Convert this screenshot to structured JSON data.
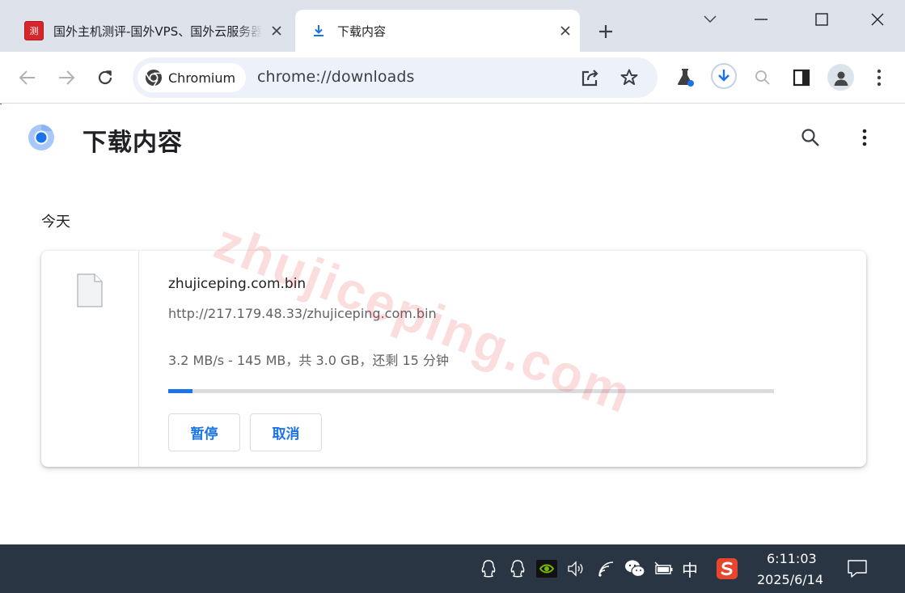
{
  "window": {
    "tabs": [
      {
        "title": "国外主机测评-国外VPS、国外云服务器",
        "favicon": "site-logo-icon",
        "favicon_text": "测"
      },
      {
        "title": "下载内容",
        "favicon": "download-icon",
        "active": true
      }
    ],
    "controls": [
      "chevron-down-icon",
      "minimize-icon",
      "maximize-icon",
      "close-icon"
    ]
  },
  "toolbar": {
    "chip_label": "Chromium",
    "url": "chrome://downloads",
    "icons": [
      "back-icon",
      "forward-icon",
      "reload-icon",
      "share-icon",
      "star-icon",
      "labs-flask-icon",
      "download-indicator-icon",
      "search-icon",
      "side-panel-icon",
      "profile-avatar-icon",
      "kebab-menu-icon"
    ]
  },
  "page": {
    "title": "下载内容",
    "section_date": "今天",
    "download": {
      "filename": "zhujiceping.com.bin",
      "url": "http://217.179.48.33/zhujiceping.com.bin",
      "status": "3.2 MB/s - 145 MB，共 3.0 GB，还剩 15 分钟",
      "progress_fraction": 0.04,
      "pause_label": "暂停",
      "cancel_label": "取消"
    },
    "watermark": "zhujiceping.com"
  },
  "taskbar": {
    "ime_label": "中",
    "time": "6:11:03",
    "date": "2025/6/14"
  },
  "colors": {
    "accent": "#1a73e8",
    "tabstrip": "#dee3eb",
    "taskbar": "#2a3543",
    "watermark": "#e82d2d"
  }
}
